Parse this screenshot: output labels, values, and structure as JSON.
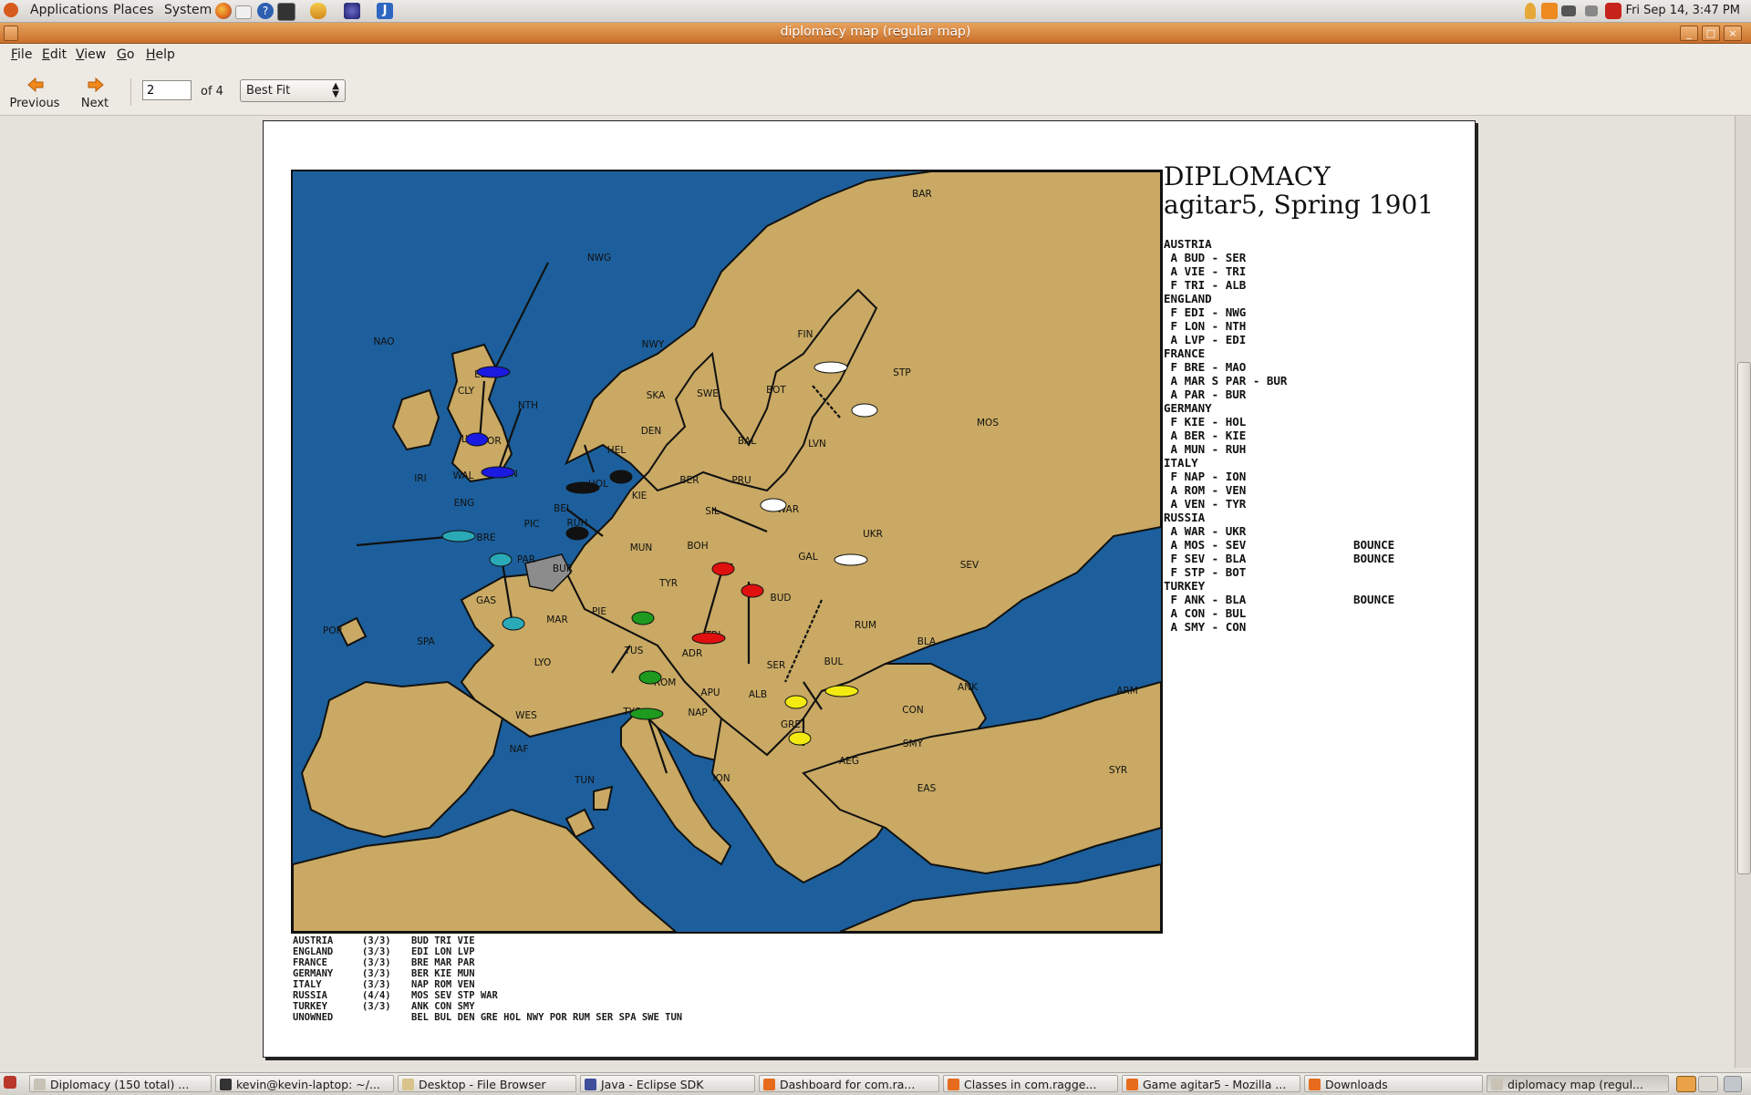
{
  "top_panel": {
    "menus": [
      "Applications",
      "Places",
      "System"
    ],
    "clock": "Fri Sep 14,  3:47 PM"
  },
  "window": {
    "title": "diplomacy map (regular map)"
  },
  "menubar": [
    {
      "label": "File",
      "mnemonic": "F",
      "rest": "ile"
    },
    {
      "label": "Edit",
      "mnemonic": "E",
      "rest": "dit"
    },
    {
      "label": "View",
      "mnemonic": "V",
      "rest": "iew"
    },
    {
      "label": "Go",
      "mnemonic": "G",
      "rest": "o"
    },
    {
      "label": "Help",
      "mnemonic": "H",
      "rest": "elp"
    }
  ],
  "toolbar": {
    "previous_label": "Previous",
    "next_label": "Next",
    "page_value": "2",
    "page_total": "of 4",
    "zoom_value": "Best Fit"
  },
  "document": {
    "title_line1": "DIPLOMACY",
    "title_line2": "agitar5, Spring 1901",
    "orders": [
      {
        "text": "AUSTRIA",
        "result": ""
      },
      {
        "text": " A BUD - SER",
        "result": ""
      },
      {
        "text": " A VIE - TRI",
        "result": ""
      },
      {
        "text": " F TRI - ALB",
        "result": ""
      },
      {
        "text": "ENGLAND",
        "result": ""
      },
      {
        "text": " F EDI - NWG",
        "result": ""
      },
      {
        "text": " F LON - NTH",
        "result": ""
      },
      {
        "text": " A LVP - EDI",
        "result": ""
      },
      {
        "text": "FRANCE",
        "result": ""
      },
      {
        "text": " F BRE - MAO",
        "result": ""
      },
      {
        "text": " A MAR S PAR - BUR",
        "result": ""
      },
      {
        "text": " A PAR - BUR",
        "result": ""
      },
      {
        "text": "GERMANY",
        "result": ""
      },
      {
        "text": " F KIE - HOL",
        "result": ""
      },
      {
        "text": " A BER - KIE",
        "result": ""
      },
      {
        "text": " A MUN - RUH",
        "result": ""
      },
      {
        "text": "ITALY",
        "result": ""
      },
      {
        "text": " F NAP - ION",
        "result": ""
      },
      {
        "text": " A ROM - VEN",
        "result": ""
      },
      {
        "text": " A VEN - TYR",
        "result": ""
      },
      {
        "text": "RUSSIA",
        "result": ""
      },
      {
        "text": " A WAR - UKR",
        "result": ""
      },
      {
        "text": " A MOS - SEV",
        "result": "BOUNCE"
      },
      {
        "text": " F SEV - BLA",
        "result": "BOUNCE"
      },
      {
        "text": " F STP - BOT",
        "result": ""
      },
      {
        "text": "TURKEY",
        "result": ""
      },
      {
        "text": " F ANK - BLA",
        "result": "BOUNCE"
      },
      {
        "text": " A CON - BUL",
        "result": ""
      },
      {
        "text": " A SMY - CON",
        "result": ""
      }
    ],
    "supply_centers": [
      {
        "power": "AUSTRIA",
        "count": "(3/3)",
        "centers": "BUD TRI VIE"
      },
      {
        "power": "ENGLAND",
        "count": "(3/3)",
        "centers": "EDI LON LVP"
      },
      {
        "power": "FRANCE",
        "count": "(3/3)",
        "centers": "BRE MAR PAR"
      },
      {
        "power": "GERMANY",
        "count": "(3/3)",
        "centers": "BER KIE MUN"
      },
      {
        "power": "ITALY",
        "count": "(3/3)",
        "centers": "NAP ROM VEN"
      },
      {
        "power": "RUSSIA",
        "count": "(4/4)",
        "centers": "MOS SEV STP WAR"
      },
      {
        "power": "TURKEY",
        "count": "(3/3)",
        "centers": "ANK CON SMY"
      },
      {
        "power": "UNOWNED",
        "count": "",
        "centers": "BEL BUL DEN GRE HOL NWY POR RUM SER SPA SWE TUN"
      }
    ],
    "map_labels": [
      "BAR",
      "NWG",
      "NAO",
      "NWY",
      "FIN",
      "STP",
      "CLY",
      "EDI",
      "SKA",
      "SWE",
      "BOT",
      "NTH",
      "YOR",
      "DEN",
      "LVP",
      "BAL",
      "LVN",
      "MOS",
      "HEL",
      "IRI",
      "WAL",
      "LON",
      "HOL",
      "BER",
      "PRU",
      "KIE",
      "ENG",
      "PIC",
      "BEL",
      "SIL",
      "WAR",
      "RUH",
      "MUN",
      "BOH",
      "UKR",
      "BRE",
      "PAR",
      "GAL",
      "SEV",
      "BUR",
      "VIE",
      "TYR",
      "BUD",
      "GAS",
      "MAR",
      "PIE",
      "VEN",
      "TRI",
      "RUM",
      "POR",
      "SPA",
      "LYO",
      "TUS",
      "ADR",
      "BLA",
      "SER",
      "BUL",
      "ANK",
      "ROM",
      "APU",
      "ALB",
      "CON",
      "ARM",
      "WES",
      "TYS",
      "NAP",
      "GRE",
      "SMY",
      "NAF",
      "TUN",
      "ION",
      "AEG",
      "EAS",
      "SYR"
    ],
    "colors": {
      "sea": "#1c5f9c",
      "land": "#c9a963",
      "austria": "#e01010",
      "england": "#1a1ae0",
      "france": "#2aa9b7",
      "germany": "#111111",
      "italy": "#1e9a1e",
      "russia": "#ffffff",
      "turkey": "#f2ea10",
      "switzerland": "#8c8c8c"
    }
  },
  "taskbar": [
    {
      "label": "Diplomacy (150 total) ...",
      "active": false
    },
    {
      "label": "kevin@kevin-laptop: ~/...",
      "active": false
    },
    {
      "label": "Desktop - File Browser",
      "active": false
    },
    {
      "label": "Java - Eclipse SDK",
      "active": false
    },
    {
      "label": "Dashboard for com.ra...",
      "active": false
    },
    {
      "label": "Classes in com.ragge...",
      "active": false
    },
    {
      "label": "Game agitar5 - Mozilla ...",
      "active": false
    },
    {
      "label": "Downloads",
      "active": false
    },
    {
      "label": "diplomacy map (regul...",
      "active": true
    }
  ]
}
